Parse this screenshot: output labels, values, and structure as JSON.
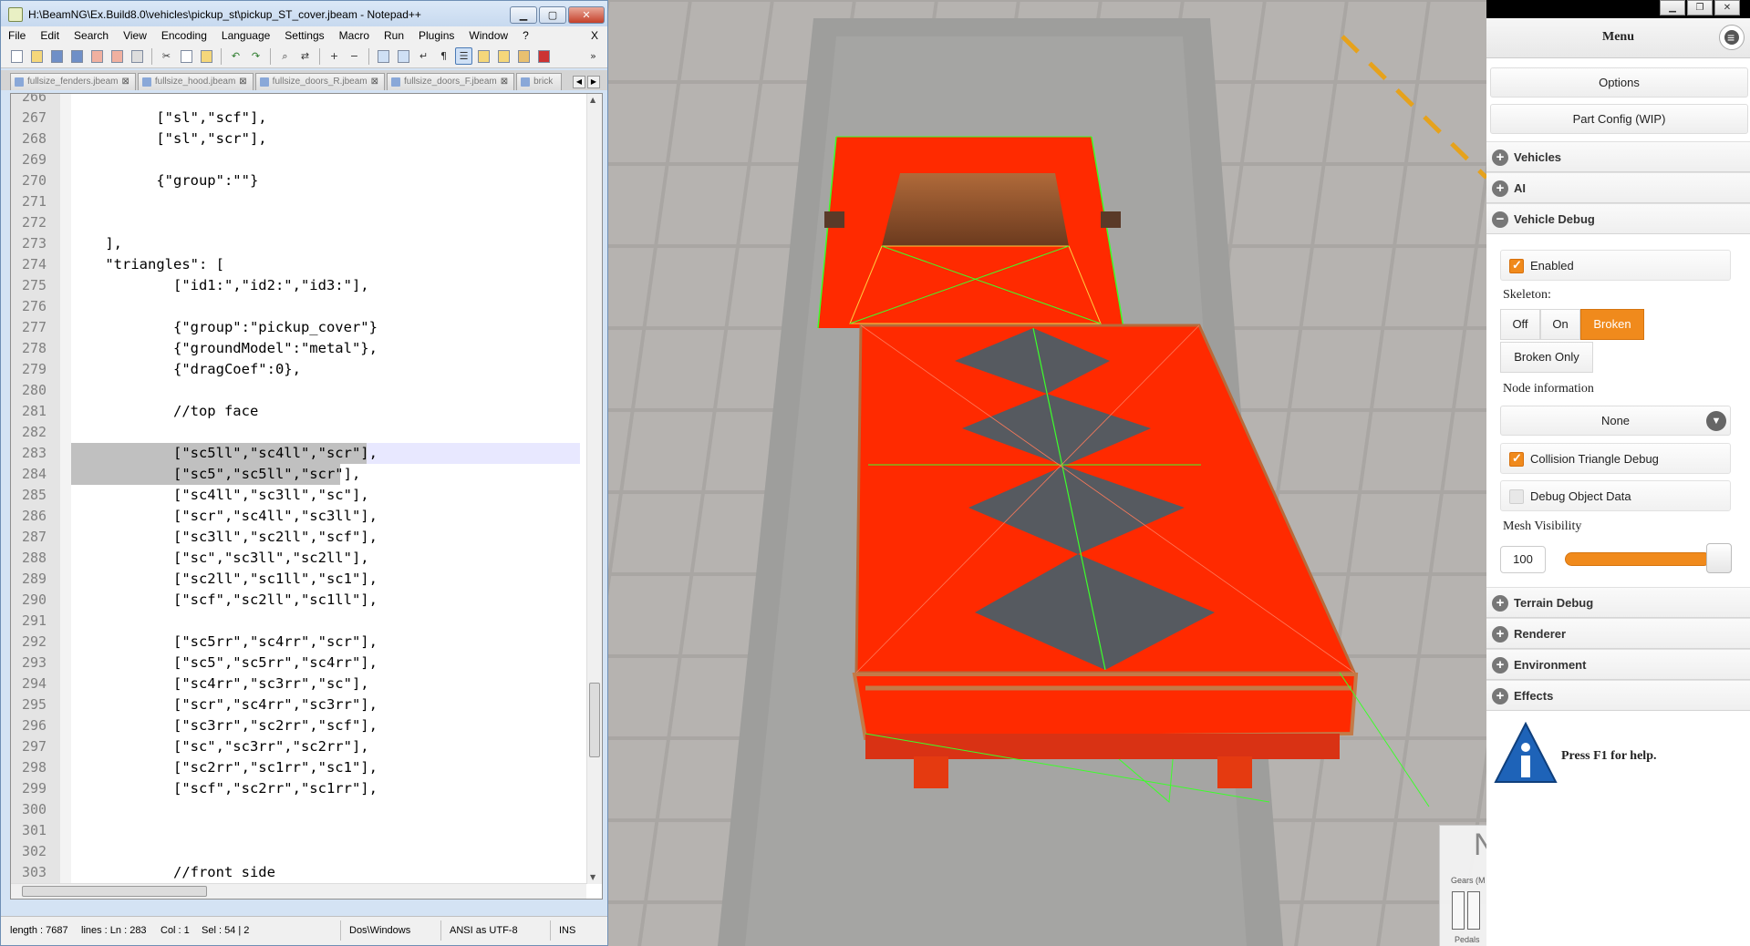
{
  "npp": {
    "title": "H:\\BeamNG\\Ex.Build8.0\\vehicles\\pickup_st\\pickup_ST_cover.jbeam - Notepad++",
    "menu": [
      "File",
      "Edit",
      "Search",
      "View",
      "Encoding",
      "Language",
      "Settings",
      "Macro",
      "Run",
      "Plugins",
      "Window",
      "?"
    ],
    "menu_close": "X",
    "tabs": [
      "fullsize_fenders.jbeam",
      "fullsize_hood.jbeam",
      "fullsize_doors_R.jbeam",
      "fullsize_doors_F.jbeam",
      "brick"
    ],
    "lines": [
      {
        "n": "266",
        "t": ""
      },
      {
        "n": "267",
        "t": "          [\"sl\",\"scf\"],"
      },
      {
        "n": "268",
        "t": "          [\"sl\",\"scr\"],"
      },
      {
        "n": "269",
        "t": ""
      },
      {
        "n": "270",
        "t": "          {\"group\":\"\"}"
      },
      {
        "n": "271",
        "t": ""
      },
      {
        "n": "272",
        "t": ""
      },
      {
        "n": "273",
        "t": "    ],"
      },
      {
        "n": "274",
        "t": "    \"triangles\": ["
      },
      {
        "n": "275",
        "t": "            [\"id1:\",\"id2:\",\"id3:\"],"
      },
      {
        "n": "276",
        "t": ""
      },
      {
        "n": "277",
        "t": "            {\"group\":\"pickup_cover\"}"
      },
      {
        "n": "278",
        "t": "            {\"groundModel\":\"metal\"},"
      },
      {
        "n": "279",
        "t": "            {\"dragCoef\":0},"
      },
      {
        "n": "280",
        "t": ""
      },
      {
        "n": "281",
        "t": "            //top face"
      },
      {
        "n": "282",
        "t": ""
      },
      {
        "n": "283",
        "t": "            [\"sc5ll\",\"sc4ll\",\"scr\"],"
      },
      {
        "n": "284",
        "t": "            [\"sc5\",\"sc5ll\",\"scr\"],"
      },
      {
        "n": "285",
        "t": "            [\"sc4ll\",\"sc3ll\",\"sc\"],"
      },
      {
        "n": "286",
        "t": "            [\"scr\",\"sc4ll\",\"sc3ll\"],"
      },
      {
        "n": "287",
        "t": "            [\"sc3ll\",\"sc2ll\",\"scf\"],"
      },
      {
        "n": "288",
        "t": "            [\"sc\",\"sc3ll\",\"sc2ll\"],"
      },
      {
        "n": "289",
        "t": "            [\"sc2ll\",\"sc1ll\",\"sc1\"],"
      },
      {
        "n": "290",
        "t": "            [\"scf\",\"sc2ll\",\"sc1ll\"],"
      },
      {
        "n": "291",
        "t": ""
      },
      {
        "n": "292",
        "t": "            [\"sc5rr\",\"sc4rr\",\"scr\"],"
      },
      {
        "n": "293",
        "t": "            [\"sc5\",\"sc5rr\",\"sc4rr\"],"
      },
      {
        "n": "294",
        "t": "            [\"sc4rr\",\"sc3rr\",\"sc\"],"
      },
      {
        "n": "295",
        "t": "            [\"scr\",\"sc4rr\",\"sc3rr\"],"
      },
      {
        "n": "296",
        "t": "            [\"sc3rr\",\"sc2rr\",\"scf\"],"
      },
      {
        "n": "297",
        "t": "            [\"sc\",\"sc3rr\",\"sc2rr\"],"
      },
      {
        "n": "298",
        "t": "            [\"sc2rr\",\"sc1rr\",\"sc1\"],"
      },
      {
        "n": "299",
        "t": "            [\"scf\",\"sc2rr\",\"sc1rr\"],"
      },
      {
        "n": "300",
        "t": ""
      },
      {
        "n": "301",
        "t": ""
      },
      {
        "n": "302",
        "t": ""
      },
      {
        "n": "303",
        "t": "            //front side"
      }
    ],
    "status": {
      "length": "length : 7687",
      "lines": "lines : Ln : 283",
      "col": "Col : 1",
      "sel": "Sel : 54 | 2",
      "eol": "Dos\\Windows",
      "encoding": "ANSI as UTF-8",
      "mode": "INS"
    }
  },
  "menu_panel": {
    "title": "Menu",
    "options_label": "Options",
    "part_config_label": "Part Config (WIP)",
    "sections_top": [
      {
        "sign": "+",
        "label": "Vehicles"
      },
      {
        "sign": "+",
        "label": "AI"
      },
      {
        "sign": "−",
        "label": "Vehicle Debug"
      }
    ],
    "enabled_label": "Enabled",
    "skeleton_label": "Skeleton:",
    "skeleton_options": [
      "Off",
      "On",
      "Broken"
    ],
    "skeleton_selected": "Broken",
    "broken_only_label": "Broken Only",
    "node_info_label": "Node information",
    "node_info_value": "None",
    "collision_label": "Collision Triangle Debug",
    "debug_object_label": "Debug Object Data",
    "mesh_visibility_label": "Mesh Visibility",
    "mesh_visibility_value": "100",
    "sections_bottom": [
      {
        "sign": "+",
        "label": "Terrain Debug"
      },
      {
        "sign": "+",
        "label": "Renderer"
      },
      {
        "sign": "+",
        "label": "Environment"
      },
      {
        "sign": "+",
        "label": "Effects"
      }
    ],
    "help_text": "Press F1 for help."
  },
  "hud": {
    "big": "N",
    "gears": "Gears (M",
    "pedals": "Pedals"
  },
  "colors": {
    "accent": "#f08a1c",
    "debug_red": "#ff2a00",
    "wire_green": "#3cff2a"
  }
}
